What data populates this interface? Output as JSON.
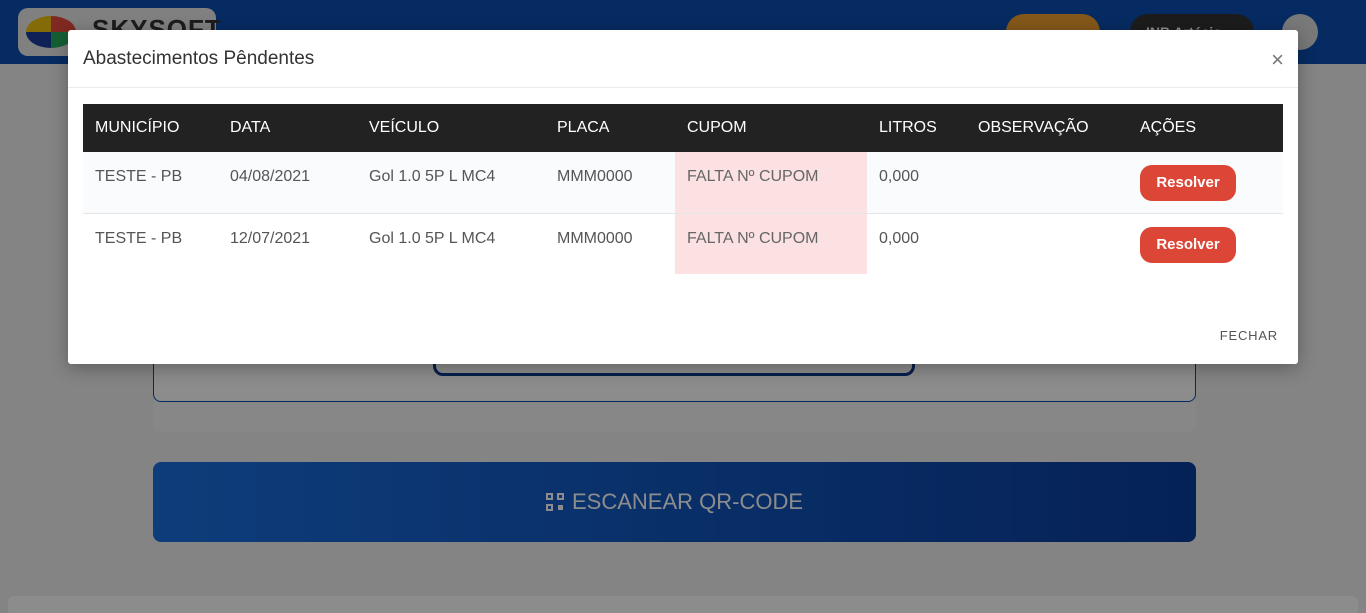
{
  "background": {
    "logo_text": "SKYSOFT",
    "user_button_label": "INB Artécio",
    "scan_button_label": "ESCANEAR QR-CODE"
  },
  "modal": {
    "title": "Abastecimentos Pêndentes",
    "close_symbol": "×",
    "footer_button_label": "FECHAR",
    "table": {
      "headers": [
        "MUNICÍPIO",
        "DATA",
        "VEÍCULO",
        "PLACA",
        "CUPOM",
        "LITROS",
        "OBSERVAÇÃO",
        "AÇÕES"
      ],
      "rows": [
        {
          "municipio": "TESTE - PB",
          "data": "04/08/2021",
          "veiculo": "Gol 1.0 5P L MC4",
          "placa": "MMM0000",
          "cupom": "FALTA Nº CUPOM",
          "litros": "0,000",
          "observacao": "",
          "acao": "Resolver"
        },
        {
          "municipio": "TESTE - PB",
          "data": "12/07/2021",
          "veiculo": "Gol 1.0 5P L MC4",
          "placa": "MMM0000",
          "cupom": "FALTA Nº CUPOM",
          "litros": "0,000",
          "observacao": "",
          "acao": "Resolver"
        }
      ]
    }
  },
  "colors": {
    "header_blue": "#0b4fb3",
    "resolve_red": "#dc4636",
    "cupom_highlight": "#fbe1e2"
  }
}
